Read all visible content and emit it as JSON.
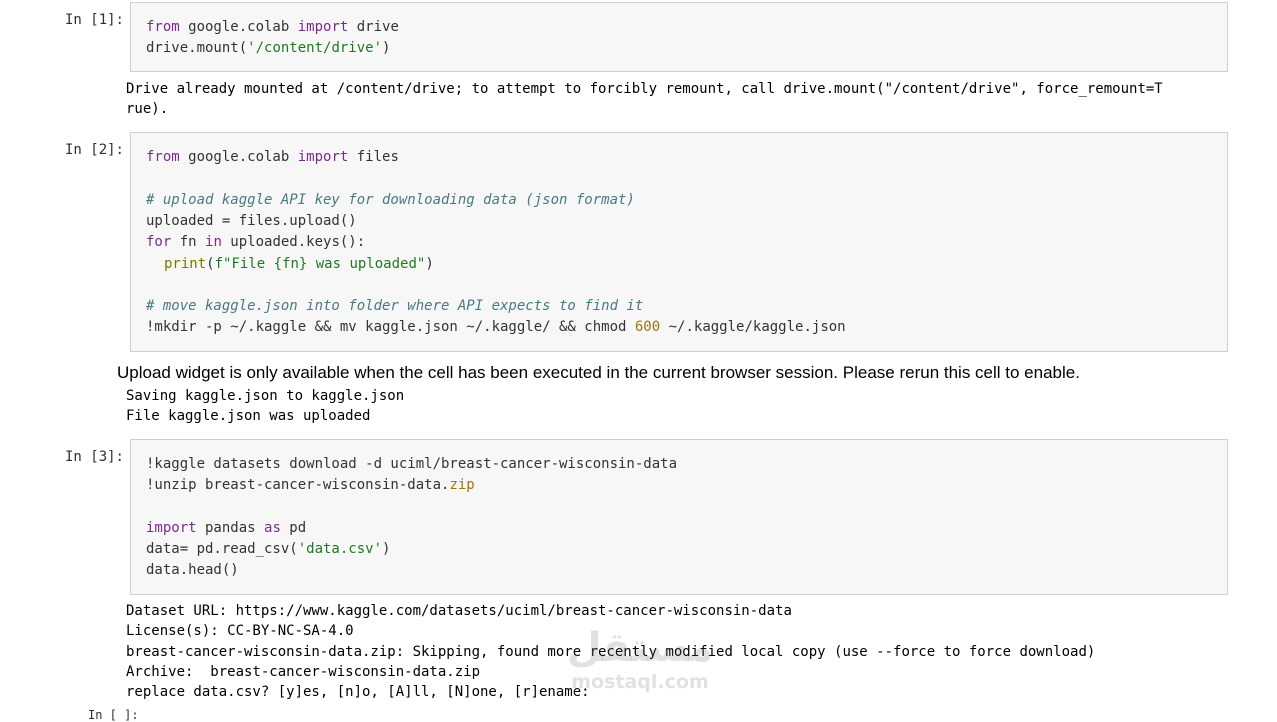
{
  "cells": [
    {
      "prompt": "In [1]:",
      "code": {
        "l1_kw1": "from",
        "l1_t1": " google.colab ",
        "l1_kw2": "import",
        "l1_t2": " drive",
        "l2_t1": "drive.mount(",
        "l2_st": "'/content/drive'",
        "l2_t2": ")"
      },
      "output": [
        "Drive already mounted at /content/drive; to attempt to forcibly remount, call drive.mount(\"/content/drive\", force_remount=T",
        "rue)."
      ]
    },
    {
      "prompt": "In [2]:",
      "code": {
        "l1_kw1": "from",
        "l1_t1": " google.colab ",
        "l1_kw2": "import",
        "l1_t2": " files",
        "l3_cm": "# upload kaggle API key for downloading data (json format)",
        "l4_t1": "uploaded = files.upload()",
        "l5_kw1": "for",
        "l5_t1": " fn ",
        "l5_kw2": "in",
        "l5_t2": " uploaded.keys():",
        "l6_bi": "print",
        "l6_t1": "(",
        "l6_st": "f\"File {fn} was uploaded\"",
        "l6_t2": ")",
        "l8_cm": "# move kaggle.json into folder where API expects to find it",
        "l9_t1": "!mkdir -p ~/.kaggle && mv kaggle.json ~/.kaggle/ && chmod ",
        "l9_nu": "600",
        "l9_t2": " ~/.kaggle/kaggle.json"
      },
      "widget_note": "Upload widget is only available when the cell has been executed in the current browser session. Please rerun this cell to enable.",
      "output": [
        "Saving kaggle.json to kaggle.json",
        "File kaggle.json was uploaded"
      ]
    },
    {
      "prompt": "In [3]:",
      "code": {
        "l1_t1": "!kaggle datasets download -d uciml/breast-cancer-wisconsin-data",
        "l2_t1": "!unzip breast-cancer-wisconsin-data.",
        "l2_nu": "zip",
        "l4_kw1": "import",
        "l4_t1": " pandas ",
        "l4_kw2": "as",
        "l4_t2": " pd",
        "l5_t1": "data= pd.read_csv(",
        "l5_st": "'data.csv'",
        "l5_t2": ")",
        "l6_t1": "data.head()"
      },
      "output": [
        "Dataset URL: https://www.kaggle.com/datasets/uciml/breast-cancer-wisconsin-data",
        "License(s): CC-BY-NC-SA-4.0",
        "breast-cancer-wisconsin-data.zip: Skipping, found more recently modified local copy (use --force to force download)",
        "Archive:  breast-cancer-wisconsin-data.zip",
        "replace data.csv? [y]es, [n]o, [A]ll, [N]one, [r]ename:"
      ]
    }
  ],
  "watermark": {
    "arabic": "مستقل",
    "latin": "mostaql.com"
  },
  "cutoff_prompt": "In [ ]:"
}
